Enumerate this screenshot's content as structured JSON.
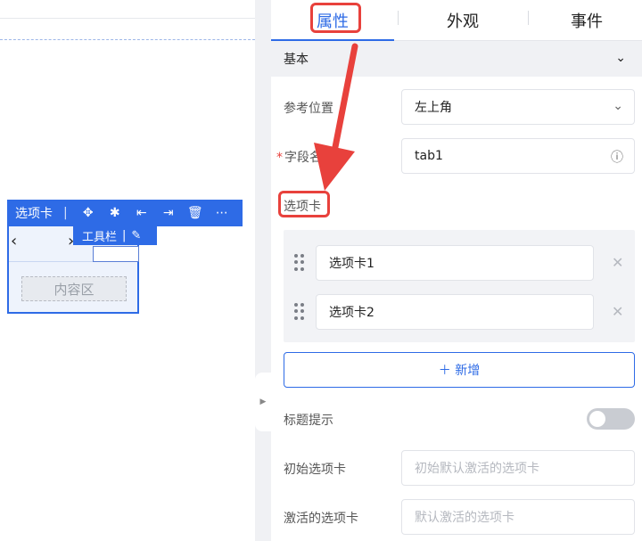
{
  "canvas": {
    "component_toolbar": {
      "label": "选项卡",
      "icons": [
        "move-icon",
        "bug-icon",
        "move-left-icon",
        "move-right-icon",
        "delete-icon",
        "more-icon"
      ]
    },
    "sub_toolbar": {
      "label": "工具栏",
      "icon": "brush-icon"
    },
    "tabs_component": {
      "prev": "‹",
      "next": "›",
      "content_placeholder": "内容区"
    }
  },
  "panel": {
    "tabs": [
      {
        "label": "属性",
        "active": true
      },
      {
        "label": "外观",
        "active": false
      },
      {
        "label": "事件",
        "active": false
      }
    ],
    "section": {
      "title": "基本",
      "expanded": true
    },
    "fields": {
      "ref_position": {
        "label": "参考位置",
        "value": "左上角"
      },
      "field_name": {
        "label": "字段名",
        "value": "tab1",
        "required": true
      },
      "options_label": "选项卡",
      "options": [
        "选项卡1",
        "选项卡2"
      ],
      "add_label": "＋ 新增",
      "title_tip": {
        "label": "标题提示",
        "enabled": false
      },
      "initial_tab": {
        "label": "初始选项卡",
        "placeholder": "初始默认激活的选项卡"
      },
      "active_tab": {
        "label": "激活的选项卡",
        "placeholder": "默认激活的选项卡"
      }
    }
  },
  "colors": {
    "accent": "#2e6be6",
    "annotation": "#e8413c"
  }
}
